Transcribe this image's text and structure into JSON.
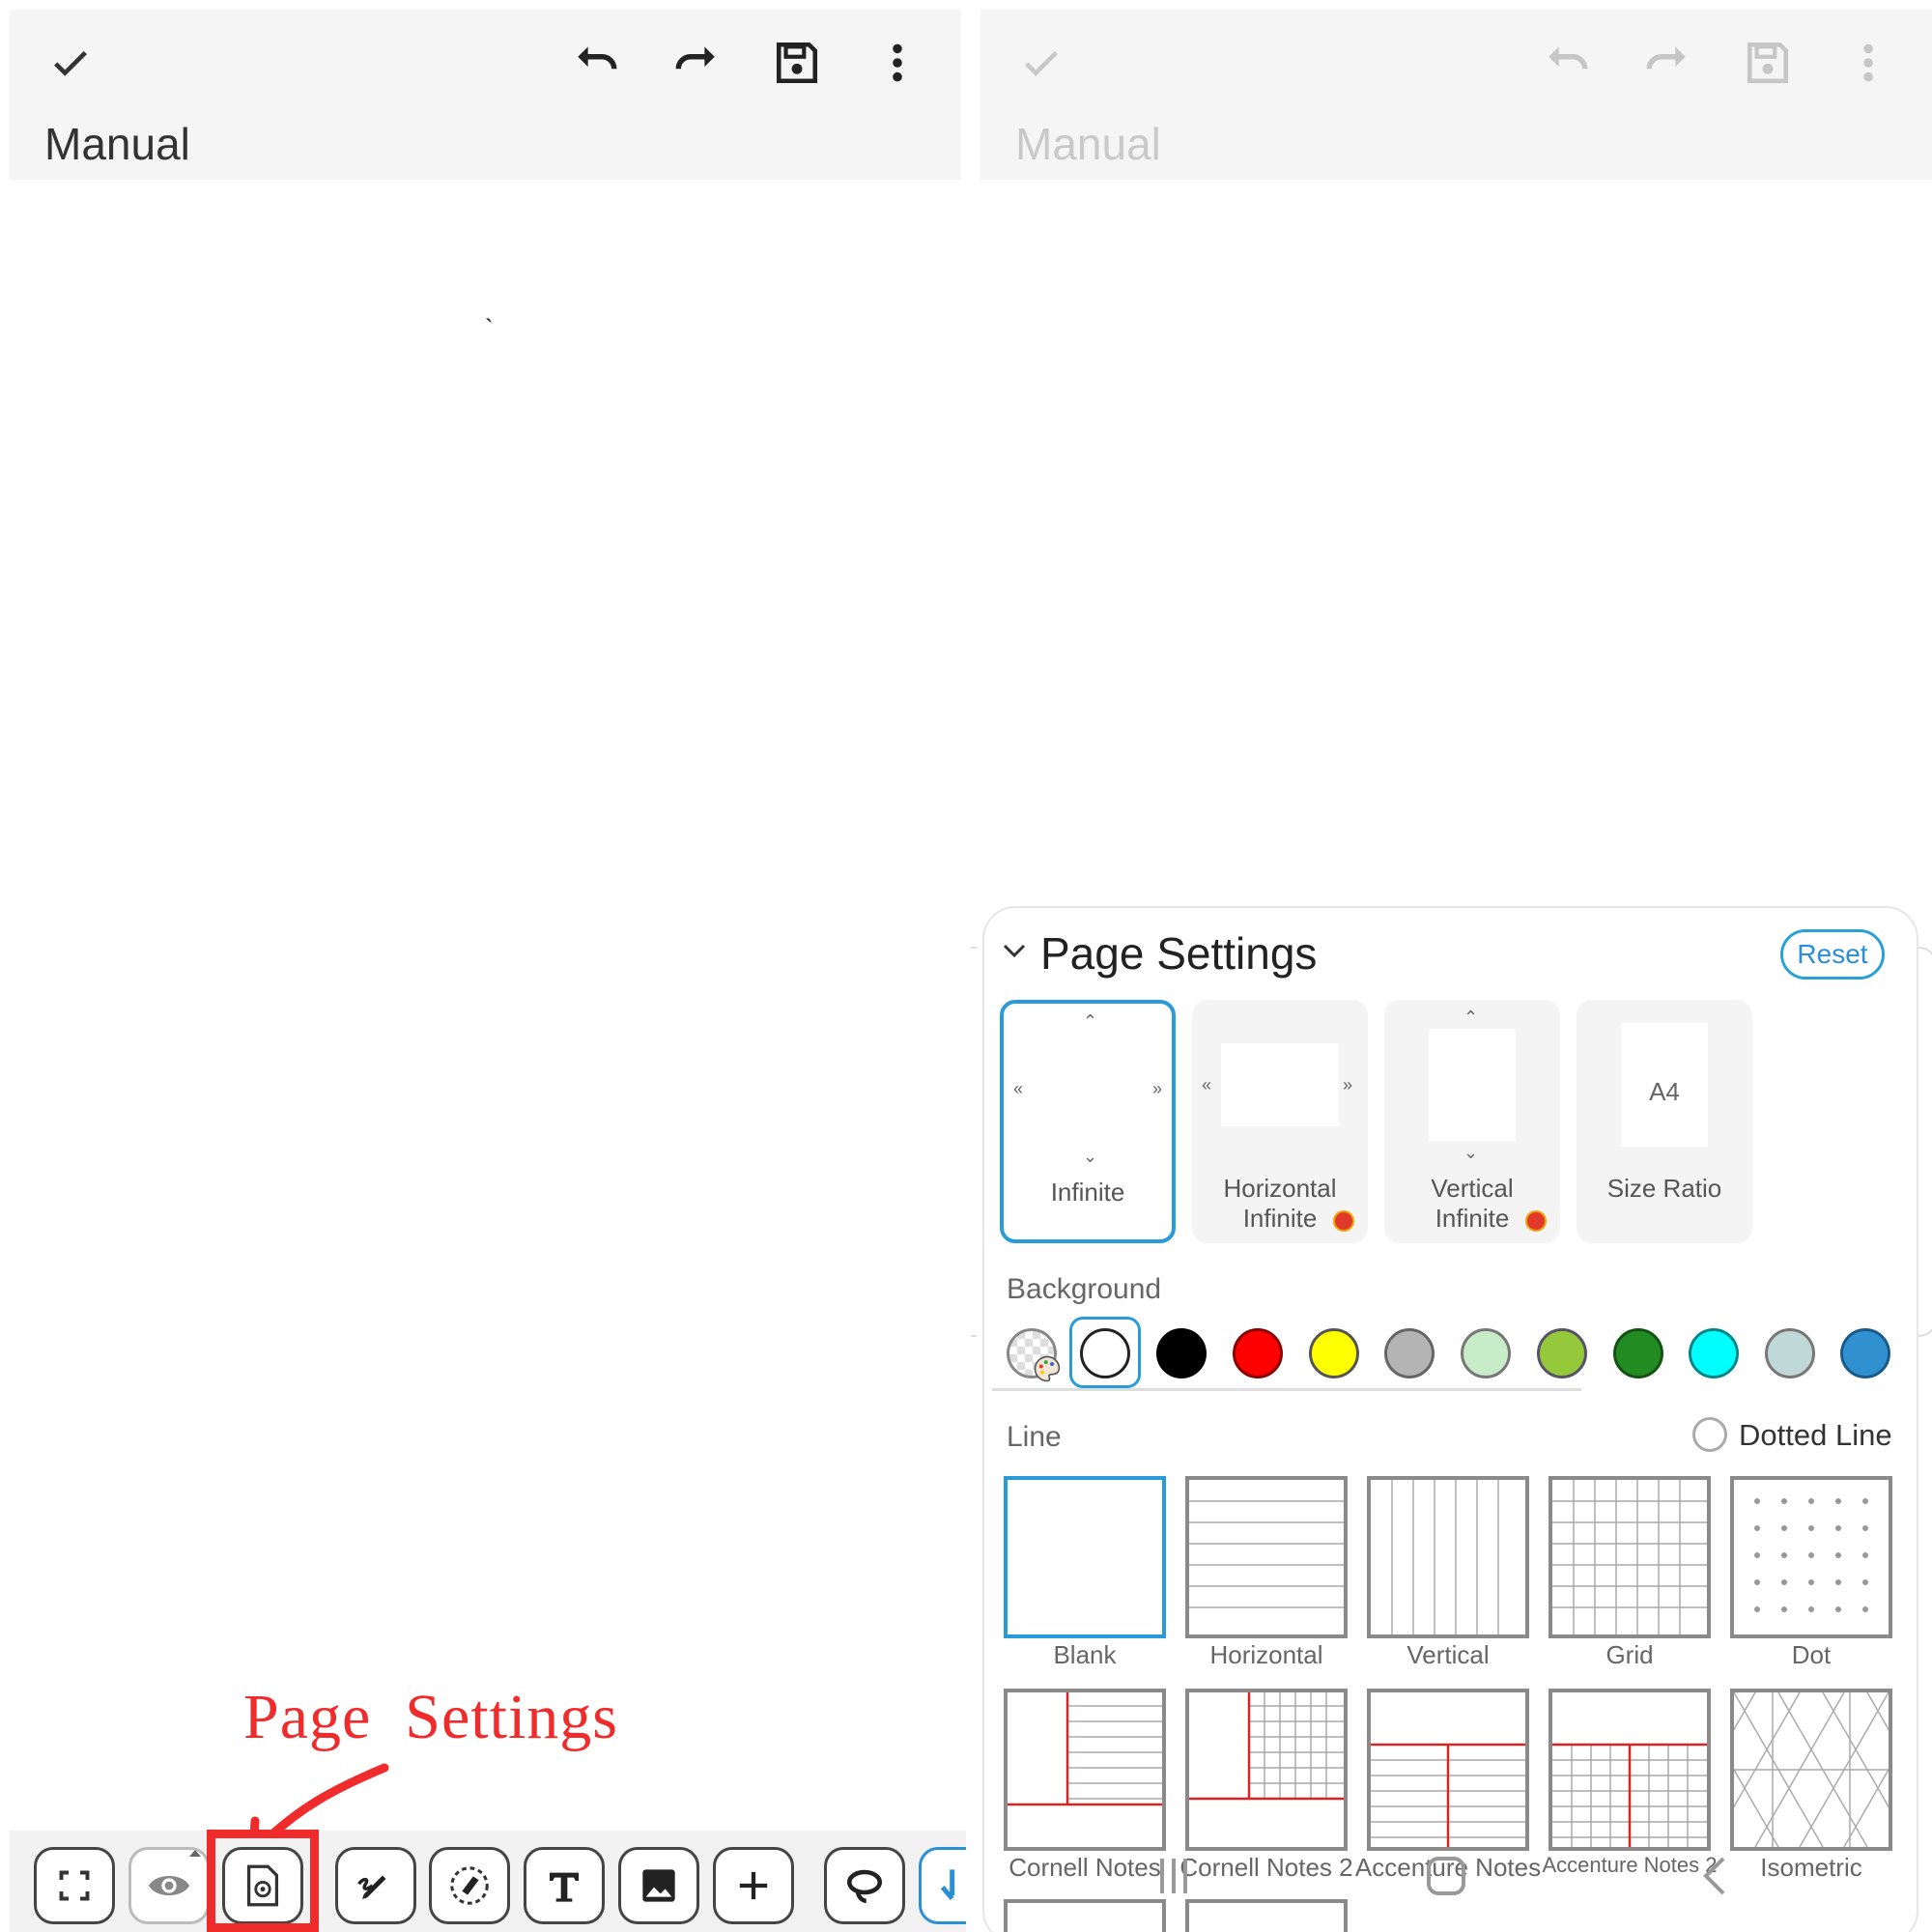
{
  "left": {
    "header": {
      "title": "Manual"
    },
    "annotation": {
      "label": "Page  Settings"
    }
  },
  "right": {
    "header": {
      "title": "Manual"
    },
    "page_settings": {
      "title": "Page Settings",
      "reset_label": "Reset",
      "modes": [
        {
          "label": "Infinite",
          "selected": true
        },
        {
          "label": "Horizontal\nInfinite",
          "premium": true
        },
        {
          "label": "Vertical\nInfinite",
          "premium": true
        },
        {
          "label": "Size Ratio",
          "inner_text": "A4"
        }
      ],
      "background_label": "Background",
      "background_colors": [
        "custom",
        "#ffffff",
        "#000000",
        "#ff0000",
        "#ffff00",
        "#b4b4b4",
        "#c8ecc8",
        "#96c83c",
        "#228b22",
        "#00ffff",
        "#c0d8d8",
        "#3090d0"
      ],
      "selected_background": "#ffffff",
      "line_label": "Line",
      "dotted_line_label": "Dotted Line",
      "templates": [
        {
          "label": "Blank",
          "selected": true
        },
        {
          "label": "Horizontal"
        },
        {
          "label": "Vertical"
        },
        {
          "label": "Grid"
        },
        {
          "label": "Dot"
        },
        {
          "label": "Cornell Notes"
        },
        {
          "label": "Cornell Notes 2"
        },
        {
          "label": "Accenture Notes"
        },
        {
          "label": "Accenture Notes 2"
        },
        {
          "label": "Isometric"
        }
      ],
      "accent_color": "#2a9bd9"
    }
  }
}
